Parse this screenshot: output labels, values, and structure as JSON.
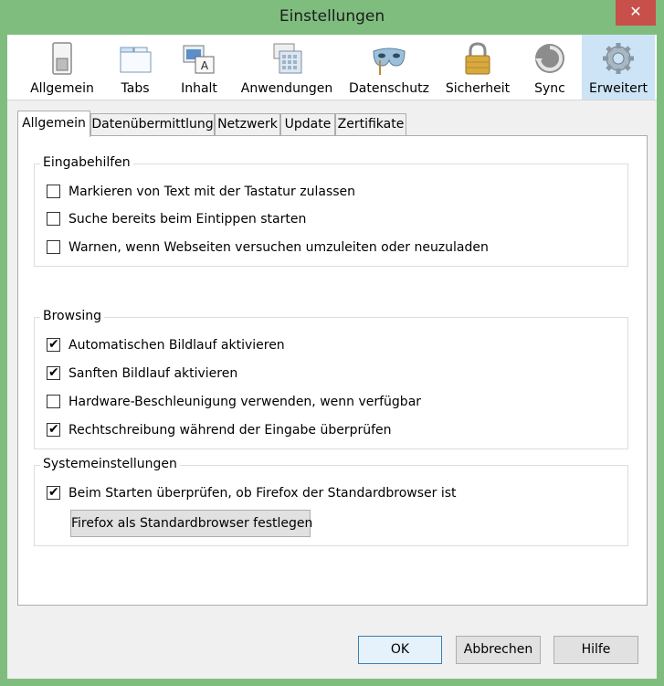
{
  "window": {
    "title": "Einstellungen",
    "close_glyph": "✕"
  },
  "toolbar": {
    "items": [
      {
        "label": "Allgemein",
        "icon": "switch-icon"
      },
      {
        "label": "Tabs",
        "icon": "tabs-icon"
      },
      {
        "label": "Inhalt",
        "icon": "content-icon"
      },
      {
        "label": "Anwendungen",
        "icon": "applications-icon"
      },
      {
        "label": "Datenschutz",
        "icon": "mask-icon"
      },
      {
        "label": "Sicherheit",
        "icon": "padlock-icon"
      },
      {
        "label": "Sync",
        "icon": "sync-icon"
      },
      {
        "label": "Erweitert",
        "icon": "gear-icon",
        "selected": true
      }
    ]
  },
  "tabs": [
    {
      "label": "Allgemein",
      "active": true
    },
    {
      "label": "Datenübermittlung"
    },
    {
      "label": "Netzwerk"
    },
    {
      "label": "Update"
    },
    {
      "label": "Zertifikate"
    }
  ],
  "groups": {
    "accessibility": {
      "caption": "Eingabehilfen",
      "items": [
        {
          "label": "Markieren von Text mit der Tastatur zulassen",
          "checked": false
        },
        {
          "label": "Suche bereits beim Eintippen starten",
          "checked": false
        },
        {
          "label": "Warnen, wenn Webseiten versuchen umzuleiten oder neuzuladen",
          "checked": false
        }
      ]
    },
    "browsing": {
      "caption": "Browsing",
      "items": [
        {
          "label": "Automatischen Bildlauf aktivieren",
          "checked": true
        },
        {
          "label": "Sanften Bildlauf aktivieren",
          "checked": true
        },
        {
          "label": "Hardware-Beschleunigung verwenden, wenn verfügbar",
          "checked": false
        },
        {
          "label": "Rechtschreibung während der Eingabe überprüfen",
          "checked": true
        }
      ]
    },
    "system": {
      "caption": "Systemeinstellungen",
      "items": [
        {
          "label": "Beim Starten überprüfen, ob Firefox der Standardbrowser ist",
          "checked": true
        }
      ],
      "button_label": "Firefox als Standardbrowser festlegen"
    }
  },
  "dialog_buttons": {
    "ok": "OK",
    "cancel": "Abbrechen",
    "help": "Hilfe"
  },
  "check_glyph": "✔",
  "colors": {
    "accent_selected": "#cde4f7",
    "frame": "#7fbd7f",
    "close": "#c7504a"
  }
}
